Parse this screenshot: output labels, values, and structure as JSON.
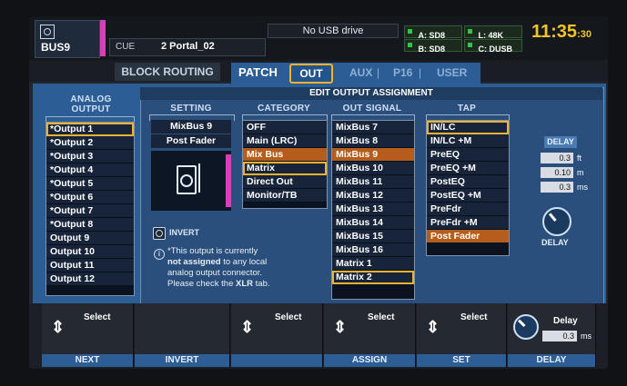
{
  "header": {
    "bus_label": "BUS9",
    "cue_label": "CUE",
    "scene_name": "2 Portal_02",
    "usb_status": "No USB drive",
    "indicators": [
      {
        "key": "A",
        "value": "SD8"
      },
      {
        "key": "L",
        "value": "48K"
      },
      {
        "key": "B",
        "value": "SD8"
      },
      {
        "key": "C",
        "value": "DUSB"
      }
    ],
    "time": "11:35",
    "seconds": ":30"
  },
  "tabs": {
    "block_routing": "BLOCK ROUTING",
    "patch": "PATCH",
    "out": "OUT",
    "aux": "AUX",
    "p16": "P16",
    "user": "USER"
  },
  "analog_output": {
    "heading_line1": "ANALOG",
    "heading_line2": "OUTPUT",
    "items": [
      "*Output 1",
      "*Output 2",
      "*Output 3",
      "*Output 4",
      "*Output 5",
      "*Output 6",
      "*Output 7",
      "*Output 8",
      "Output 9",
      "Output 10",
      "Output 11",
      "Output 12"
    ]
  },
  "edit": {
    "title": "EDIT OUTPUT ASSIGNMENT",
    "setting_header": "SETTING",
    "setting_bus": "MixBus 9",
    "setting_tap": "Post Fader",
    "category_header": "CATEGORY",
    "categories": [
      "OFF",
      "Main (LRC)",
      "Mix Bus",
      "Matrix",
      "Direct Out",
      "Monitor/TB"
    ],
    "out_signal_header": "OUT SIGNAL",
    "out_signals": [
      "MixBus 7",
      "MixBus 8",
      "MixBus 9",
      "MixBus 10",
      "MixBus 11",
      "MixBus 12",
      "MixBus 13",
      "MixBus 14",
      "MixBus 15",
      "MixBus 16",
      "Matrix 1",
      "Matrix 2"
    ],
    "tap_header": "TAP",
    "taps": [
      "IN/LC",
      "IN/LC +M",
      "PreEQ",
      "PreEQ +M",
      "PostEQ",
      "PostEQ +M",
      "PreFdr",
      "PreFdr +M",
      "Post Fader"
    ],
    "invert_label": "INVERT",
    "notice_line1": "This output is currently",
    "notice_line2_bold": "not assigned",
    "notice_line2_rest": "to any local",
    "notice_line3": "analog output connector.",
    "notice_line4_pre": "Please check the",
    "notice_line4_bold": "XLR",
    "notice_line4_post": "tab.",
    "delay_header": "DELAY",
    "delay_values": [
      {
        "value": "0.3",
        "unit": "ft"
      },
      {
        "value": "0.10",
        "unit": "m"
      },
      {
        "value": "0.3",
        "unit": "ms"
      }
    ],
    "delay_knob_label": "DELAY"
  },
  "softkeys": [
    {
      "select": "Select",
      "label": "NEXT"
    },
    {
      "select": "",
      "label": "INVERT"
    },
    {
      "select": "Select",
      "label": ""
    },
    {
      "select": "Select",
      "label": "ASSIGN"
    },
    {
      "select": "Select",
      "label": "SET"
    },
    {
      "select": "Delay",
      "label": "DELAY",
      "value": "0.3",
      "unit": "ms"
    }
  ],
  "colors": {
    "panel_blue": "#2c5d95",
    "select_orange": "#f0b230",
    "highlight_orange": "#b45d1c",
    "clock_yellow": "#f2c526",
    "bus_magenta": "#d63fb8"
  }
}
